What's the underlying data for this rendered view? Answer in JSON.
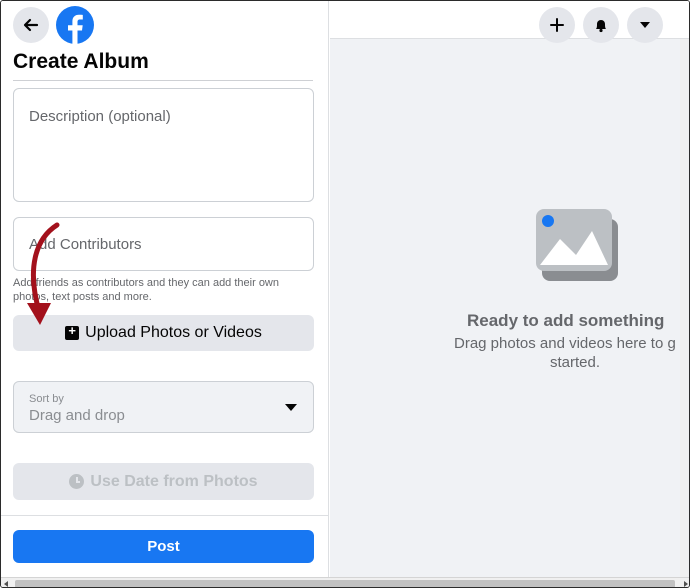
{
  "header": {
    "logo_icon": "facebook-logo-icon",
    "back_icon": "back-arrow-icon"
  },
  "form": {
    "title": "Create Album",
    "description_placeholder": "Description (optional)",
    "contributors_placeholder": "Add Contributors",
    "contributors_help": "Add friends as contributors and they can add their own photos, text posts and more.",
    "upload_label": "Upload Photos or Videos",
    "sort_label": "Sort by",
    "sort_value": "Drag and drop",
    "date_label": "Use Date from Photos",
    "post_label": "Post"
  },
  "preview": {
    "title": "Ready to add something",
    "subtitle_line1": "Drag photos and videos here to g",
    "subtitle_line2": "started."
  },
  "colors": {
    "brand_blue": "#1877f2",
    "annotation_arrow": "#a3111c",
    "panel_gray": "#f0f2f5"
  }
}
